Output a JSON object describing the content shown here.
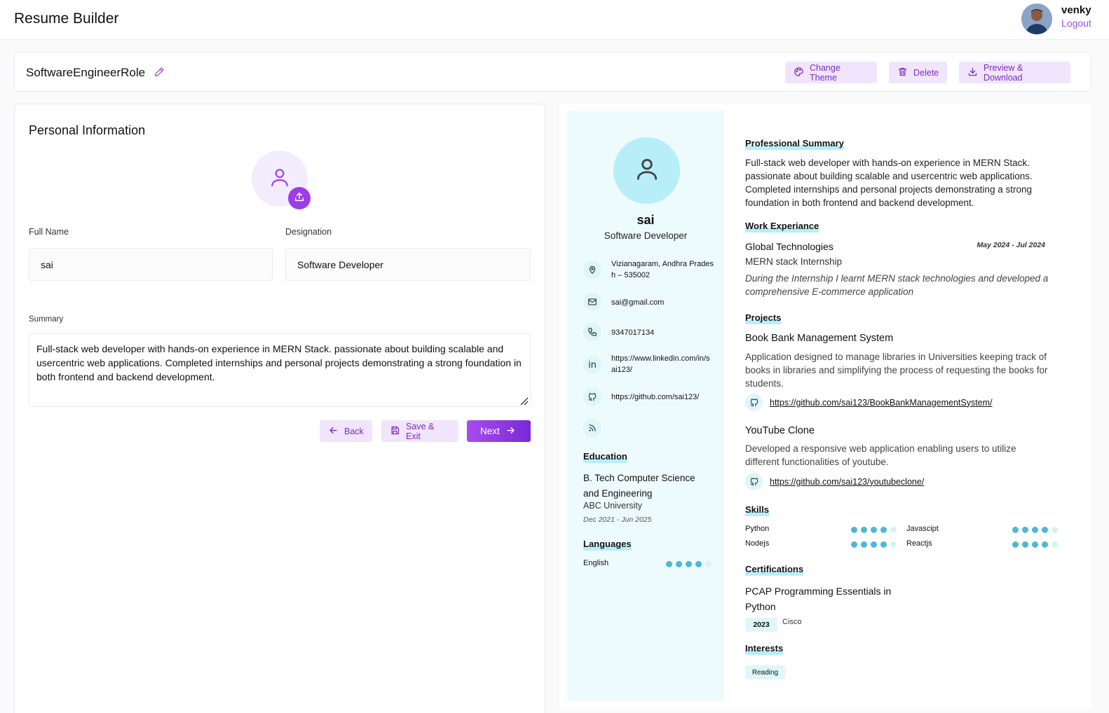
{
  "app": {
    "title": "Resume Builder"
  },
  "user": {
    "name": "venky",
    "logout_label": "Logout"
  },
  "toolbar": {
    "resume_name": "SoftwareEngineerRole",
    "change_theme": "Change Theme",
    "delete": "Delete",
    "preview_download": "Preview & Download"
  },
  "form": {
    "heading": "Personal Information",
    "full_name_label": "Full Name",
    "full_name_value": "sai",
    "designation_label": "Designation",
    "designation_value": "Software Developer",
    "summary_label": "Summary",
    "summary_value": "Full-stack web developer with hands-on experience in MERN Stack. passionate about building scalable and usercentric web applications. Completed internships and personal projects demonstrating a strong foundation in both frontend and backend development.",
    "back": "Back",
    "save_exit": "Save & Exit",
    "next": "Next"
  },
  "preview": {
    "name": "sai",
    "designation": "Software Developer",
    "contact": {
      "address": "Vizianagaram, Andhra Pradesh – 535002",
      "email": "sai@gmail.com",
      "phone": "9347017134",
      "linkedin": "https://www.linkedin.com/in/sai123/",
      "github": "https://github.com/sai123/"
    },
    "education_heading": "Education",
    "education": {
      "degree": "B. Tech Computer Science and Engineering",
      "school": "ABC University",
      "dates": "Dec 2021 - Jun 2025"
    },
    "languages_heading": "Languages",
    "languages": [
      {
        "name": "English",
        "level": 4,
        "max": 5
      }
    ],
    "summary_heading": "Professional Summary",
    "summary": "Full-stack web developer with hands-on experience in MERN Stack. passionate about building scalable and usercentric web applications. Completed internships and personal projects demonstrating a strong foundation in both frontend and backend development.",
    "work_heading": "Work Experiance",
    "work": {
      "company": "Global Technologies",
      "dates": "May 2024 - Jul 2024",
      "role": "MERN stack Internship",
      "description": "During the Internship I learnt MERN stack technologies and developed a comprehensive E-commerce application"
    },
    "projects_heading": "Projects",
    "projects": [
      {
        "title": "Book Bank Management System",
        "description": "Application designed to manage libraries in Universities keeping track of books in libraries and simplifying the process of requesting the books for students.",
        "link": "https://github.com/sai123/BookBankManagementSystem/"
      },
      {
        "title": "YouTube Clone",
        "description": "Developed a responsive web application enabling users to utilize different functionalities of youtube.",
        "link": "https://github.com/sai123/youtubeclone/"
      }
    ],
    "skills_heading": "Skills",
    "skills": [
      {
        "name": "Python",
        "level": 4,
        "max": 5
      },
      {
        "name": "Javascipt",
        "level": 4,
        "max": 5
      },
      {
        "name": "Nodejs",
        "level": 4,
        "max": 5
      },
      {
        "name": "Reactjs",
        "level": 4,
        "max": 5
      }
    ],
    "certifications_heading": "Certifications",
    "certification": {
      "title": "PCAP Programming Essentials in Python",
      "year": "2023",
      "issuer": "Cisco"
    },
    "interests_heading": "Interests",
    "interests": [
      "Reading"
    ]
  },
  "colors": {
    "accent": "#a24ee8",
    "button_bg": "#f1e4fd",
    "preview_sidebar": "#eefbfd",
    "skill_dot": "#4fb7d6"
  },
  "icons": [
    "edit-icon",
    "palette-icon",
    "trash-icon",
    "download-icon",
    "user-icon",
    "upload-icon",
    "arrow-left-icon",
    "save-icon",
    "arrow-right-icon",
    "location-icon",
    "mail-icon",
    "phone-icon",
    "linkedin-icon",
    "github-icon",
    "rss-icon"
  ]
}
